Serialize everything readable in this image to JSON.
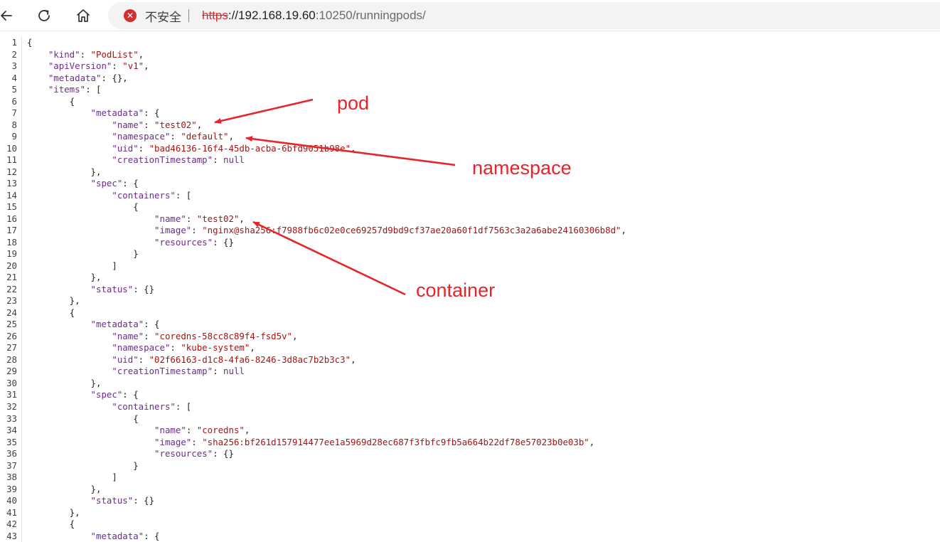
{
  "browser": {
    "security_text": "不安全",
    "url_scheme": "https",
    "url_host": "://192.168.19.60",
    "url_path": ":10250/runningpods/",
    "icons": [
      "back-arrow-icon",
      "reload-icon",
      "home-icon",
      "not-secure-icon"
    ]
  },
  "json_lines": [
    "{",
    "    \"kind\": \"PodList\",",
    "    \"apiVersion\": \"v1\",",
    "    \"metadata\": {},",
    "    \"items\": [",
    "        {",
    "            \"metadata\": {",
    "                \"name\": \"test02\",",
    "                \"namespace\": \"default\",",
    "                \"uid\": \"bad46136-16f4-45db-acba-6bfd9051b98e\",",
    "                \"creationTimestamp\": null",
    "            },",
    "            \"spec\": {",
    "                \"containers\": [",
    "                    {",
    "                        \"name\": \"test02\",",
    "                        \"image\": \"nginx@sha256:f7988fb6c02e0ce69257d9bd9cf37ae20a60f1df7563c3a2a6abe24160306b8d\",",
    "                        \"resources\": {}",
    "                    }",
    "                ]",
    "            },",
    "            \"status\": {}",
    "        },",
    "        {",
    "            \"metadata\": {",
    "                \"name\": \"coredns-58cc8c89f4-fsd5v\",",
    "                \"namespace\": \"kube-system\",",
    "                \"uid\": \"02f66163-d1c8-4fa6-8246-3d8ac7b2b3c3\",",
    "                \"creationTimestamp\": null",
    "            },",
    "            \"spec\": {",
    "                \"containers\": [",
    "                    {",
    "                        \"name\": \"coredns\",",
    "                        \"image\": \"sha256:bf261d157914477ee1a5969d28ec687f3fbfc9fb5a664b22df78e57023b0e03b\",",
    "                        \"resources\": {}",
    "                    }",
    "                ]",
    "            },",
    "            \"status\": {}",
    "        },",
    "        {",
    "            \"metadata\": {"
  ],
  "annotations": {
    "pod": "pod",
    "namespace": "namespace",
    "container": "container"
  },
  "colors": {
    "annotation": "#e8242b",
    "json_key": "#6a2d8a",
    "json_string": "#a31515"
  }
}
